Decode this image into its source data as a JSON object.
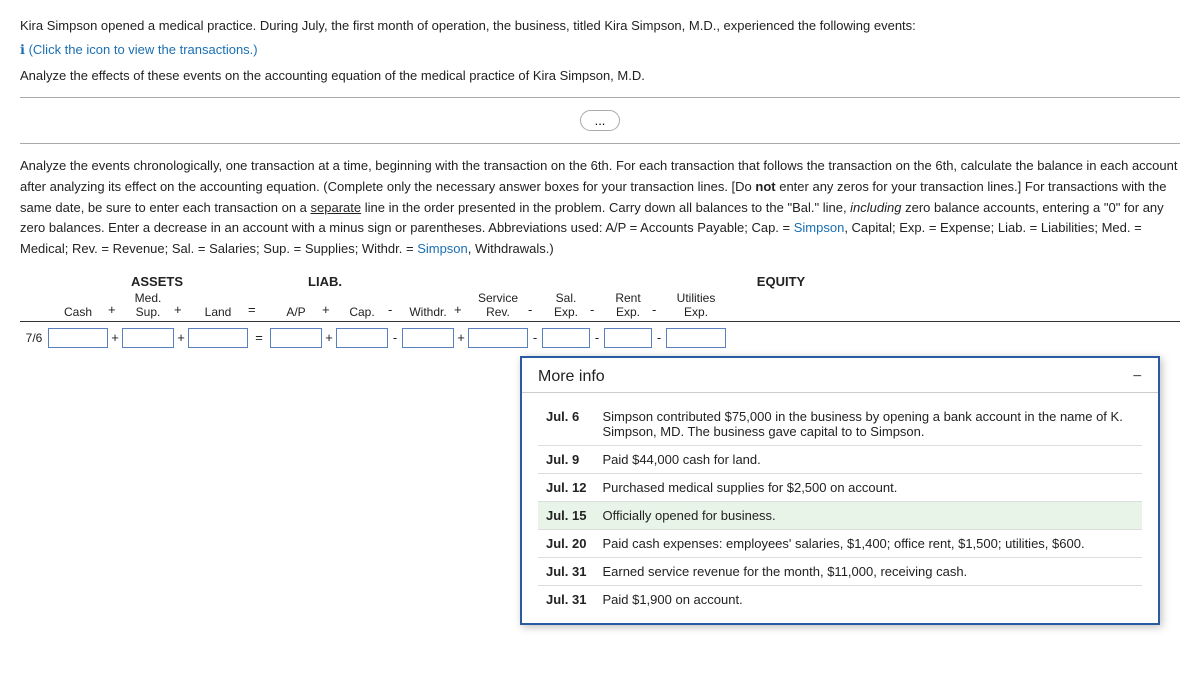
{
  "intro": {
    "main": "Kira Simpson opened a medical practice. During July, the first month of operation, the business, titled Kira Simpson, M.D., experienced the following events:",
    "click_link": "(Click the icon to view the transactions.)",
    "analyze": "Analyze the effects of these events on the accounting equation of the medical practice of Kira Simpson, M.D."
  },
  "ellipsis": "...",
  "instructions": {
    "text": "Analyze the events chronologically, one transaction at a time, beginning with the transaction on the 6th. For each transaction that follows the transaction on the 6th, calculate the balance in each account after analyzing its effect on the accounting equation. (Complete only the necessary answer boxes for your transaction lines. [Do not enter any zeros for your transaction lines.] For transactions with the same date, be sure to enter each transaction on a separate line in the order presented in the problem. Carry down all balances to the \"Bal.\" line, including zero balance accounts, entering a \"0\" for any zero balances. Enter a decrease in an account with a minus sign or parentheses. Abbreviations used: A/P = Accounts Payable; Cap. = Simpson, Capital; Exp. = Expense; Liab. = Liabilities; Med. = Medical; Rev. = Revenue; Sal. = Salaries; Sup. = Supplies; Withdr. = Simpson, Withdrawals.)"
  },
  "equation": {
    "assets_label": "ASSETS",
    "liab_label": "LIAB.",
    "equity_label": "EQUITY",
    "equals": "=",
    "plus": "+",
    "minus": "-",
    "columns": {
      "cash": "Cash",
      "med": "Med.",
      "sup": "Sup.",
      "land": "Land",
      "ap": "A/P",
      "cap": "Cap.",
      "withdr": "Withdr.",
      "service_rev": "Service",
      "service_rev2": "Rev.",
      "sal": "Sal.",
      "sal2": "Exp.",
      "rent": "Rent",
      "rent2": "Exp.",
      "utilities": "Utilities",
      "utilities2": "Exp."
    },
    "row_label": "7/6"
  },
  "more_info": {
    "title": "More info",
    "close_label": "−",
    "transactions": [
      {
        "date": "Jul. 6",
        "description": "Simpson contributed $75,000 in the business by opening a bank account in the name of K. Simpson, MD. The business gave capital to to Simpson.",
        "highlighted": false
      },
      {
        "date": "Jul. 9",
        "description": "Paid $44,000 cash for land.",
        "highlighted": false
      },
      {
        "date": "Jul. 12",
        "description": "Purchased medical supplies for $2,500 on account.",
        "highlighted": false
      },
      {
        "date": "Jul. 15",
        "description": "Officially opened for business.",
        "highlighted": true
      },
      {
        "date": "Jul. 20",
        "description": "Paid cash expenses: employees' salaries, $1,400; office rent, $1,500; utilities, $600.",
        "highlighted": false
      },
      {
        "date": "Jul. 31",
        "description": "Earned service revenue for the month, $11,000, receiving cash.",
        "highlighted": false
      },
      {
        "date": "Jul. 31",
        "description": "Paid $1,900 on account.",
        "highlighted": false
      }
    ]
  }
}
